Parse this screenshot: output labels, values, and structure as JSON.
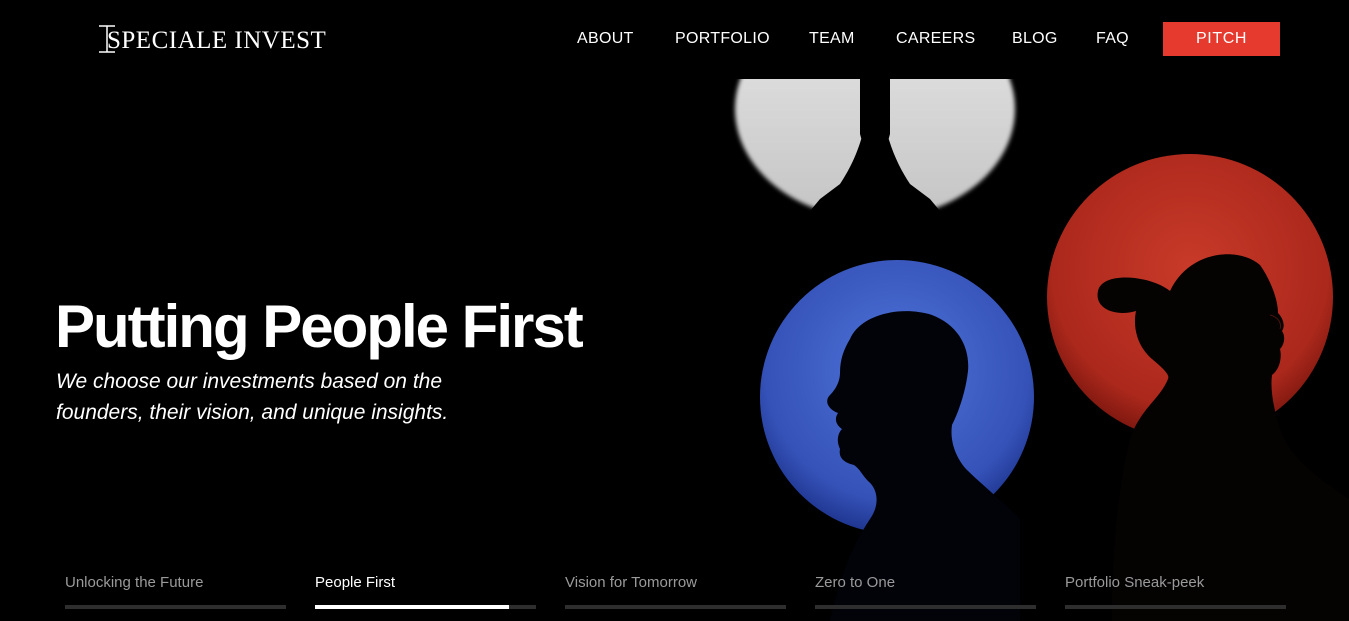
{
  "brand": {
    "name": "SPECIALE INVEST"
  },
  "nav": {
    "items": [
      {
        "label": "ABOUT"
      },
      {
        "label": "PORTFOLIO"
      },
      {
        "label": "TEAM"
      },
      {
        "label": "CAREERS"
      },
      {
        "label": "BLOG"
      },
      {
        "label": "FAQ"
      }
    ],
    "pitch_label": "PITCH"
  },
  "hero": {
    "title": "Putting People First",
    "subtitle": "We choose our investments based on the founders, their vision, and unique insights."
  },
  "tabs": [
    {
      "label": "Unlocking the Future",
      "progress": 0
    },
    {
      "label": "People First",
      "progress": 0.88,
      "active": true
    },
    {
      "label": "Vision for Tomorrow",
      "progress": 0
    },
    {
      "label": "Zero to One",
      "progress": 0
    },
    {
      "label": "Portfolio Sneak-peek",
      "progress": 0
    }
  ],
  "colors": {
    "accent": "#e53a2d",
    "blue_circle": "#3d5fc7",
    "red_circle": "#b4271d",
    "background": "#000000"
  }
}
